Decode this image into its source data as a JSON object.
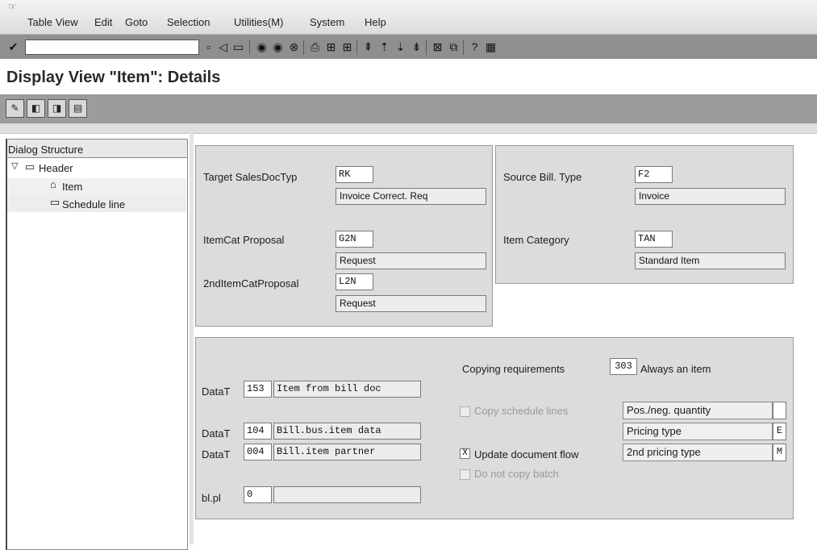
{
  "menubar": {
    "icon": "menu-icon",
    "items": [
      "Table View",
      "Edit",
      "Goto",
      "Selection",
      "Utilities(M)",
      "System",
      "Help"
    ]
  },
  "toolbar": {
    "command_field_value": "",
    "icons": [
      "enter-icon",
      "save-icon",
      "back-icon",
      "exit-icon",
      "cancel-icon",
      "print-icon",
      "find-icon",
      "find-next-icon",
      "first-page-icon",
      "previous-page-icon",
      "next-page-icon",
      "last-page-icon",
      "create-session-icon",
      "create-shortcut-icon",
      "help-icon",
      "customize-layout-icon"
    ]
  },
  "page": {
    "title": "Display View \"Item\": Details"
  },
  "app_toolbar": {
    "icons": [
      "change-display-icon",
      "previous-entry-icon",
      "next-entry-icon",
      "variable-list-icon"
    ]
  },
  "tree": {
    "header": "Dialog Structure",
    "nodes": [
      {
        "label": "Header",
        "level": 0,
        "expanded": true,
        "selected": false
      },
      {
        "label": "Item",
        "level": 1,
        "expanded": false,
        "selected": true
      },
      {
        "label": "Schedule line",
        "level": 1,
        "expanded": false,
        "selected": false
      }
    ]
  },
  "target": {
    "sales_doc_label": "Target SalesDocTyp",
    "sales_doc_code": "RK",
    "sales_doc_desc": "Invoice Correct. Req",
    "itemcat_label": "ItemCat Proposal",
    "itemcat_code": "G2N",
    "itemcat_desc": "Request",
    "itemcat2_label": "2ndItemCatProposal",
    "itemcat2_code": "L2N",
    "itemcat2_desc": "Request"
  },
  "source": {
    "bill_type_label": "Source Bill. Type",
    "bill_type_code": "F2",
    "bill_type_desc": "Invoice",
    "item_cat_label": "Item Category",
    "item_cat_code": "TAN",
    "item_cat_desc": "Standard Item"
  },
  "copy": {
    "data_transfer": [
      {
        "label": "DataT",
        "code": "153",
        "desc": "Item from bill doc"
      },
      {
        "label": "DataT",
        "code": "104",
        "desc": "Bill.bus.item data"
      },
      {
        "label": "DataT",
        "code": "004",
        "desc": "Bill.item partner"
      }
    ],
    "blpl_label": "bl.pl",
    "blpl_code": "0",
    "blpl_desc": "",
    "copy_req_label": "Copying requirements",
    "copy_req_code": "303",
    "copy_req_desc": "Always an item",
    "copy_schedule_label": "Copy schedule lines",
    "copy_schedule_checked": false,
    "update_flow_label": "Update document flow",
    "update_flow_value": "X",
    "no_copy_batch_label": "Do not copy batch",
    "no_copy_batch_checked": false,
    "pricing": [
      {
        "label": "Pos./neg. quantity",
        "value": ""
      },
      {
        "label": "Pricing type",
        "value": "E"
      },
      {
        "label": "2nd pricing type",
        "value": "M"
      }
    ]
  }
}
